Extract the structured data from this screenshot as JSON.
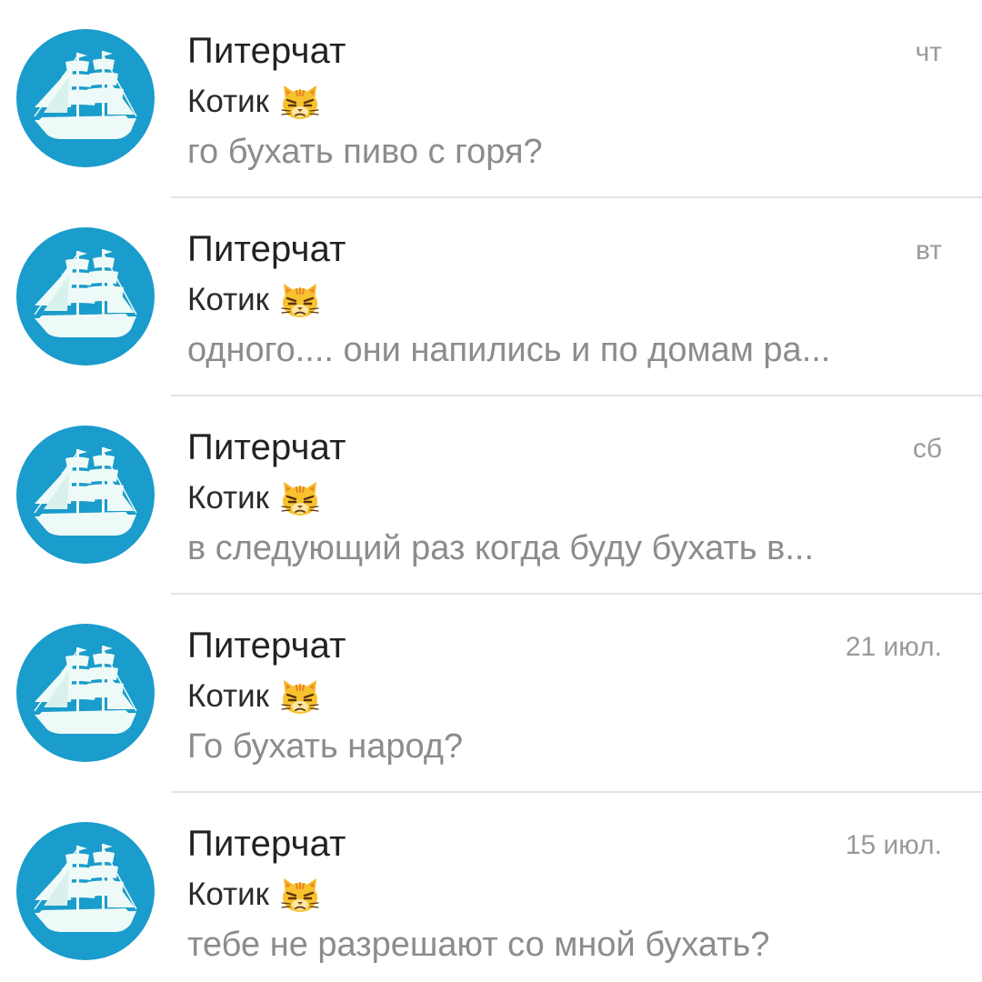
{
  "chats": [
    {
      "title": "Питерчат",
      "date": "чт",
      "sender": "Котик",
      "preview": "го бухать пиво с горя?",
      "avatar_icon": "sailing-ship-icon",
      "sender_emoji": "pouting-cat-emoji"
    },
    {
      "title": "Питерчат",
      "date": "вт",
      "sender": "Котик",
      "preview": "одного.... они напились и по домам ра...",
      "avatar_icon": "sailing-ship-icon",
      "sender_emoji": "pouting-cat-emoji"
    },
    {
      "title": "Питерчат",
      "date": "сб",
      "sender": "Котик",
      "preview": "в следующий раз когда буду бухать в...",
      "avatar_icon": "sailing-ship-icon",
      "sender_emoji": "pouting-cat-emoji"
    },
    {
      "title": "Питерчат",
      "date": "21 июл.",
      "sender": "Котик",
      "preview": "Го бухать народ?",
      "avatar_icon": "sailing-ship-icon",
      "sender_emoji": "pouting-cat-emoji"
    },
    {
      "title": "Питерчат",
      "date": "15 июл.",
      "sender": "Котик",
      "preview": "тебе не разрешают со мной бухать?",
      "avatar_icon": "sailing-ship-icon",
      "sender_emoji": "pouting-cat-emoji"
    }
  ],
  "colors": {
    "avatar_background": "#1a9ccc",
    "title_text": "#222222",
    "secondary_text": "#8c8c8c",
    "divider": "#e4e4e4"
  }
}
